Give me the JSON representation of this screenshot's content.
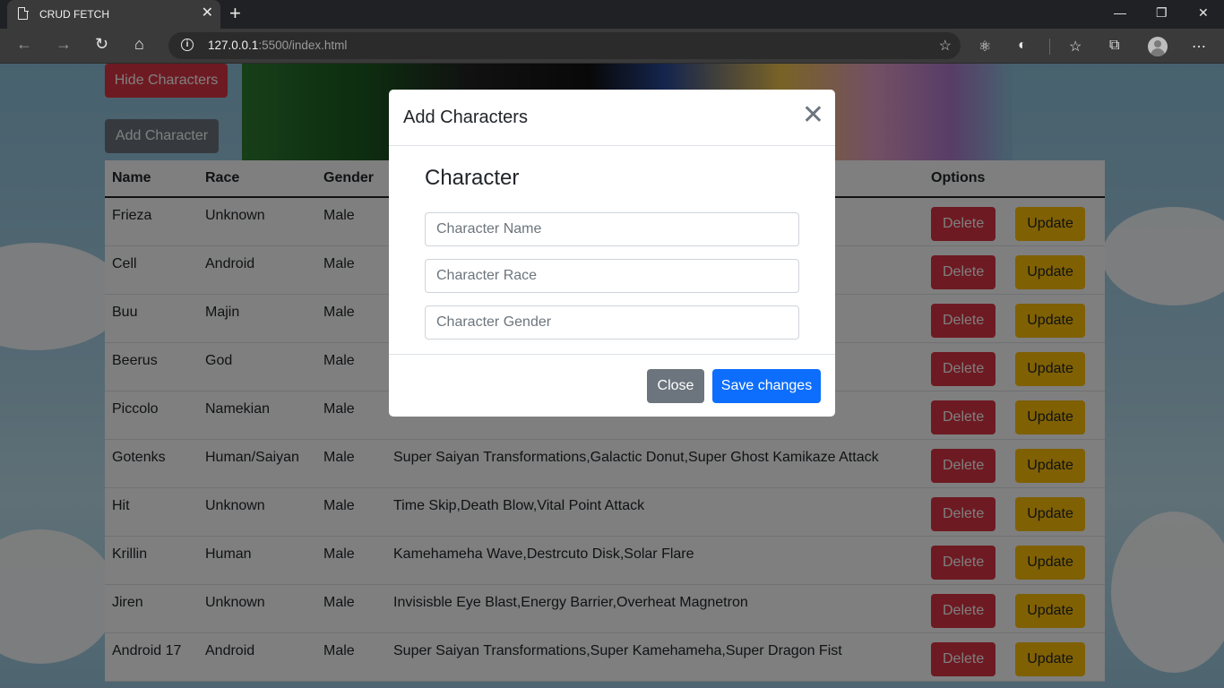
{
  "browser": {
    "tab_title": "CRUD FETCH",
    "url_host": "127.0.0.1",
    "url_rest": ":5500/index.html"
  },
  "page": {
    "hide_label": "Hide Characters",
    "add_label": "Add Character",
    "columns": [
      "Name",
      "Race",
      "Gender",
      "",
      "Options"
    ],
    "delete_label": "Delete",
    "update_label": "Update",
    "rows": [
      {
        "name": "Frieza",
        "race": "Unknown",
        "gender": "Male",
        "abilities": ""
      },
      {
        "name": "Cell",
        "race": "Android",
        "gender": "Male",
        "abilities": ""
      },
      {
        "name": "Buu",
        "race": "Majin",
        "gender": "Male",
        "abilities": ""
      },
      {
        "name": "Beerus",
        "race": "God",
        "gender": "Male",
        "abilities": ""
      },
      {
        "name": "Piccolo",
        "race": "Namekian",
        "gender": "Male",
        "abilities": ""
      },
      {
        "name": "Gotenks",
        "race": "Human/Saiyan",
        "gender": "Male",
        "abilities": "Super Saiyan Transformations,Galactic Donut,Super Ghost Kamikaze Attack"
      },
      {
        "name": "Hit",
        "race": "Unknown",
        "gender": "Male",
        "abilities": "Time Skip,Death Blow,Vital Point Attack"
      },
      {
        "name": "Krillin",
        "race": "Human",
        "gender": "Male",
        "abilities": "Kamehameha Wave,Destrcuto Disk,Solar Flare"
      },
      {
        "name": "Jiren",
        "race": "Unknown",
        "gender": "Male",
        "abilities": "Invisisble Eye Blast,Energy Barrier,Overheat Magnetron"
      },
      {
        "name": "Android 17",
        "race": "Android",
        "gender": "Male",
        "abilities": "Super Saiyan Transformations,Super Kamehameha,Super Dragon Fist"
      }
    ]
  },
  "modal": {
    "title": "Add Characters",
    "subtitle": "Character",
    "name_placeholder": "Character Name",
    "race_placeholder": "Character Race",
    "gender_placeholder": "Character Gender",
    "close_label": "Close",
    "save_label": "Save changes"
  }
}
